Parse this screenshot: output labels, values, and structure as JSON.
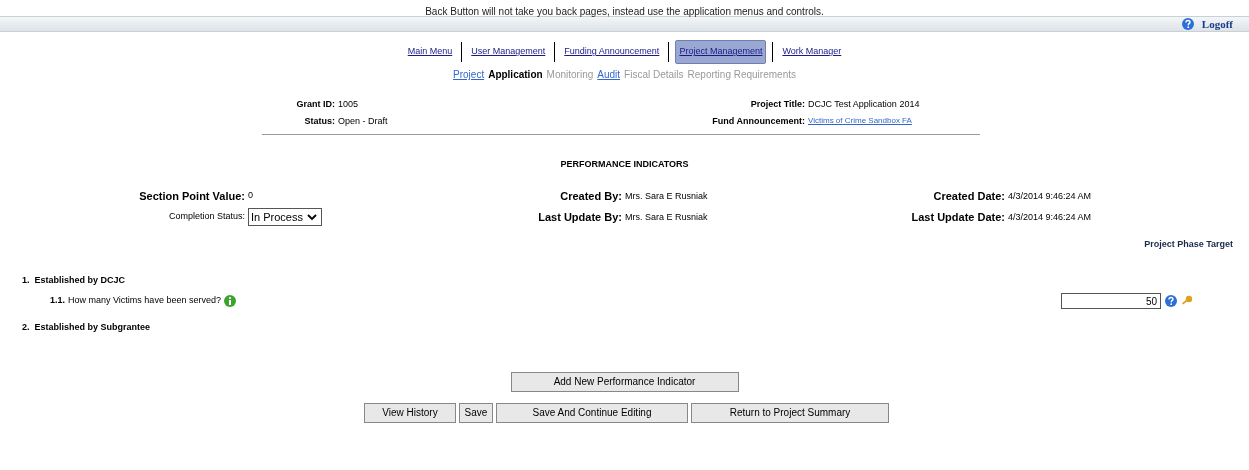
{
  "notice": "Back Button will not take you back pages, instead use the application menus and controls.",
  "top_bar": {
    "logoff": "Logoff"
  },
  "main_menu": [
    {
      "label": "Main Menu",
      "selected": false
    },
    {
      "label": "User Management",
      "selected": false
    },
    {
      "label": "Funding Announcement",
      "selected": false
    },
    {
      "label": "Project Management",
      "selected": true
    },
    {
      "label": "Work Manager",
      "selected": false
    }
  ],
  "sub_menu": [
    {
      "label": "Project",
      "kind": "link"
    },
    {
      "label": "Application",
      "kind": "current"
    },
    {
      "label": "Monitoring",
      "kind": "disabled"
    },
    {
      "label": "Audit",
      "kind": "link"
    },
    {
      "label": "Fiscal Details",
      "kind": "disabled"
    },
    {
      "label": "Reporting Requirements",
      "kind": "disabled"
    }
  ],
  "header": {
    "grant_id_label": "Grant ID:",
    "grant_id": "1005",
    "status_label": "Status:",
    "status": "Open - Draft",
    "project_title_label": "Project Title:",
    "project_title": "DCJC Test Application 2014",
    "fund_label": "Fund Announcement:",
    "fund": "Victims of Crime Sandbox FA"
  },
  "section_title": "PERFORMANCE INDICATORS",
  "info": {
    "point_label": "Section Point Value:",
    "point": "0",
    "completion_label": "Completion Status:",
    "completion": "In Process",
    "created_by_label": "Created By:",
    "created_by": "Mrs. Sara E Rusniak",
    "updated_by_label": "Last Update By:",
    "updated_by": "Mrs. Sara E Rusniak",
    "created_date_label": "Created Date:",
    "created_date": "4/3/2014 9:46:24 AM",
    "updated_date_label": "Last Update Date:",
    "updated_date": "4/3/2014 9:46:24 AM"
  },
  "target_heading": "Project Phase Target",
  "groups": [
    {
      "number": "1.",
      "title": "Established by DCJC",
      "questions": [
        {
          "number": "1.1.",
          "text": "How many Victims have been served?",
          "value": "50"
        }
      ]
    },
    {
      "number": "2.",
      "title": "Established by Subgrantee"
    }
  ],
  "add_button": "Add New Performance Indicator",
  "buttons": [
    "View History",
    "Save",
    "Save And Continue Editing",
    "Return to Project Summary"
  ]
}
